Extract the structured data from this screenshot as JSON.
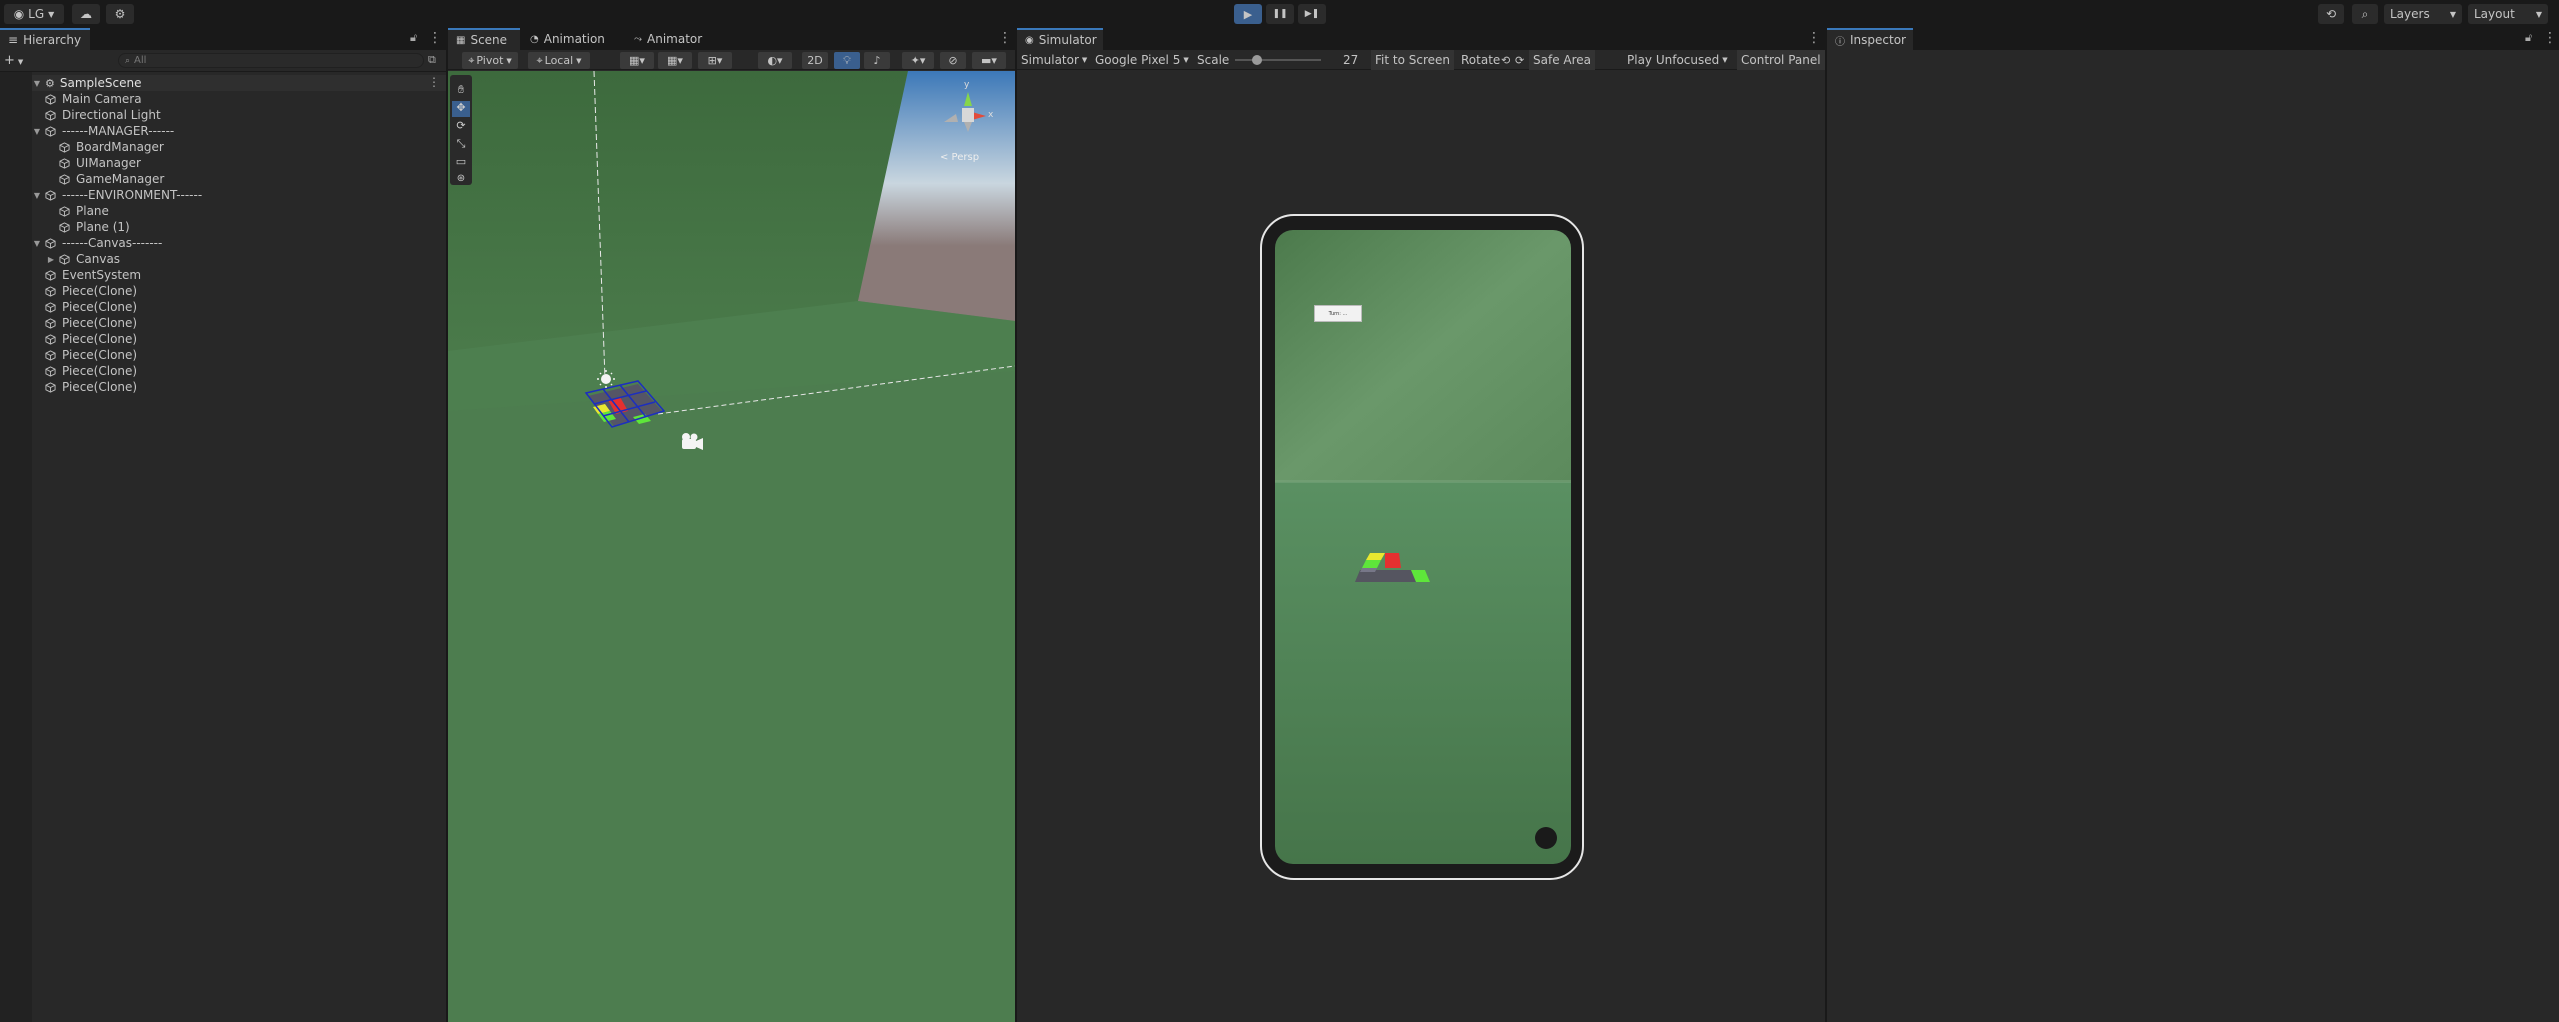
{
  "topbar": {
    "account": "LG",
    "play": "▶",
    "pause": "❚❚",
    "step": "▶❚",
    "layers": "Layers",
    "layout": "Layout"
  },
  "hierarchy": {
    "tab": "Hierarchy",
    "search_placeholder": "All",
    "scene": "SampleScene",
    "items": [
      {
        "label": "Main Camera",
        "indent": 1
      },
      {
        "label": "Directional Light",
        "indent": 1
      },
      {
        "label": "------MANAGER------",
        "indent": 1,
        "expanded": true
      },
      {
        "label": "BoardManager",
        "indent": 2
      },
      {
        "label": "UIManager",
        "indent": 2
      },
      {
        "label": "GameManager",
        "indent": 2
      },
      {
        "label": "------ENVIRONMENT------",
        "indent": 1,
        "expanded": true
      },
      {
        "label": "Plane",
        "indent": 2
      },
      {
        "label": "Plane (1)",
        "indent": 2
      },
      {
        "label": "------Canvas-------",
        "indent": 1,
        "expanded": true
      },
      {
        "label": "Canvas",
        "indent": 2,
        "collapsed": true
      },
      {
        "label": "EventSystem",
        "indent": 1
      },
      {
        "label": "Piece(Clone)",
        "indent": 1
      },
      {
        "label": "Piece(Clone)",
        "indent": 1
      },
      {
        "label": "Piece(Clone)",
        "indent": 1
      },
      {
        "label": "Piece(Clone)",
        "indent": 1
      },
      {
        "label": "Piece(Clone)",
        "indent": 1
      },
      {
        "label": "Piece(Clone)",
        "indent": 1
      },
      {
        "label": "Piece(Clone)",
        "indent": 1
      }
    ]
  },
  "scene": {
    "tabs": [
      "Scene",
      "Animation",
      "Animator"
    ],
    "pivot": "Pivot",
    "local": "Local",
    "mode_2d": "2D",
    "persp": "< Persp",
    "gizmo_y": "y",
    "gizmo_x": "x"
  },
  "simulator": {
    "tab": "Simulator",
    "mode": "Simulator",
    "device": "Google Pixel 5",
    "scale_label": "Scale",
    "scale_value": "27",
    "fit": "Fit to Screen",
    "rotate": "Rotate",
    "safe_area": "Safe Area",
    "play_mode": "Play Unfocused",
    "control_panel": "Control Panel",
    "ui_label": "Turn: ..."
  },
  "inspector": {
    "tab": "Inspector"
  },
  "colors": {
    "accent": "#3a79bb",
    "board_red": "#e53030",
    "board_yellow": "#e8e830",
    "board_green": "#5ee63a"
  }
}
